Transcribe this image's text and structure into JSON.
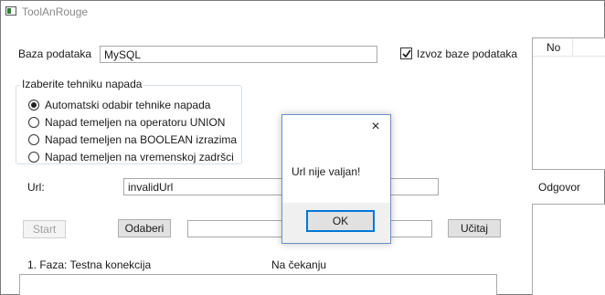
{
  "window": {
    "title": "ToolAnRouge"
  },
  "database": {
    "label": "Baza podataka",
    "value": "MySQL",
    "export_label": "Izvoz baze podataka",
    "export_checked": true
  },
  "technique": {
    "group_title": "Izaberite tehniku napada",
    "options": [
      {
        "label": "Automatski odabir tehnike napada",
        "checked": true
      },
      {
        "label": "Napad temeljen na operatoru UNION",
        "checked": false
      },
      {
        "label": "Napad temeljen na BOOLEAN izrazima",
        "checked": false
      },
      {
        "label": "Napad temeljen na vremenskoj zadršci",
        "checked": false
      }
    ]
  },
  "url": {
    "label": "Url:",
    "value": "invalidUrl"
  },
  "buttons": {
    "start": "Start",
    "browse": "Odaberi",
    "load": "Učitaj"
  },
  "status": {
    "phase": "1. Faza: Testna konekcija",
    "state": "Na čekanju"
  },
  "results": {
    "column_no": "No"
  },
  "response": {
    "label": "Odgovor"
  },
  "dialog": {
    "message": "Url nije valjan!",
    "ok": "OK",
    "close_icon": "×"
  }
}
